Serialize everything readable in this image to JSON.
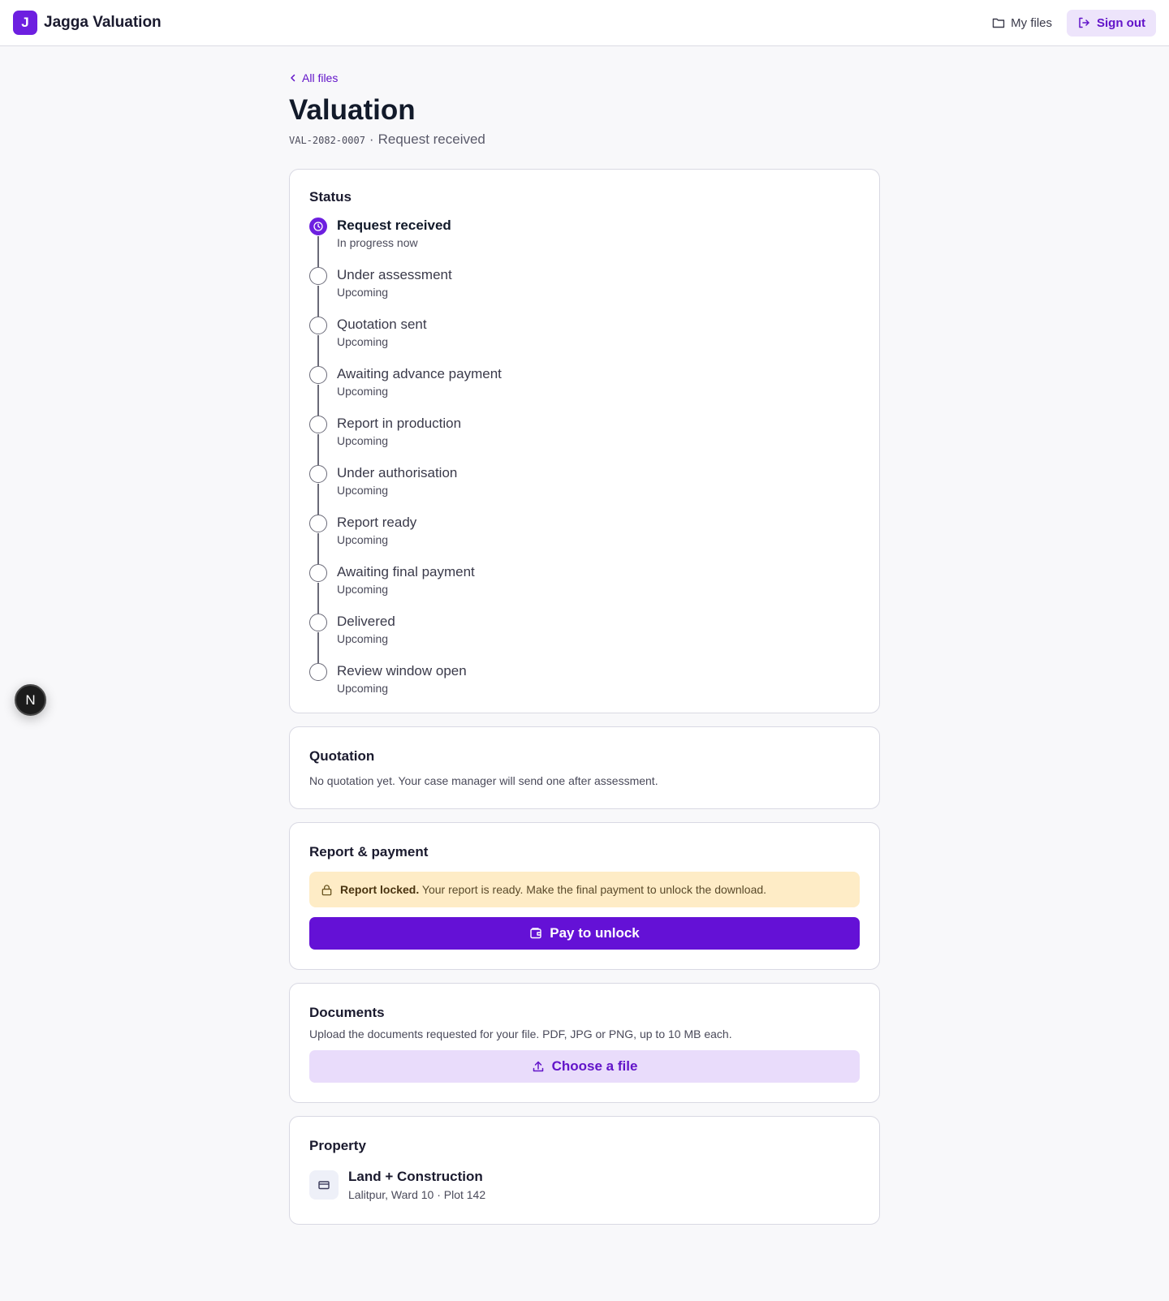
{
  "header": {
    "brand_initial": "J",
    "brand_name": "Jagga Valuation",
    "my_files_label": "My files",
    "sign_out_label": "Sign out"
  },
  "page": {
    "back_label": "All files",
    "title": "Valuation",
    "reference": "VAL-2082-0007",
    "separator": "·",
    "current_status": "Request received"
  },
  "status_card": {
    "title": "Status",
    "steps": [
      {
        "label": "Request received",
        "sub": "In progress now",
        "state": "current"
      },
      {
        "label": "Under assessment",
        "sub": "Upcoming",
        "state": "upcoming"
      },
      {
        "label": "Quotation sent",
        "sub": "Upcoming",
        "state": "upcoming"
      },
      {
        "label": "Awaiting advance payment",
        "sub": "Upcoming",
        "state": "upcoming"
      },
      {
        "label": "Report in production",
        "sub": "Upcoming",
        "state": "upcoming"
      },
      {
        "label": "Under authorisation",
        "sub": "Upcoming",
        "state": "upcoming"
      },
      {
        "label": "Report ready",
        "sub": "Upcoming",
        "state": "upcoming"
      },
      {
        "label": "Awaiting final payment",
        "sub": "Upcoming",
        "state": "upcoming"
      },
      {
        "label": "Delivered",
        "sub": "Upcoming",
        "state": "upcoming"
      },
      {
        "label": "Review window open",
        "sub": "Upcoming",
        "state": "upcoming"
      }
    ]
  },
  "quotation_card": {
    "title": "Quotation",
    "message": "No quotation yet. Your case manager will send one after assessment."
  },
  "report_card": {
    "title": "Report & payment",
    "banner_strong": "Report locked.",
    "banner_text": "Your report is ready. Make the final payment to unlock the download.",
    "pay_button": "Pay to unlock"
  },
  "documents_card": {
    "title": "Documents",
    "message": "Upload the documents requested for your file. PDF, JPG or PNG, up to 10 MB each.",
    "upload_button": "Choose a file"
  },
  "property_card": {
    "title": "Property",
    "type": "Land + Construction",
    "location": "Lalitpur, Ward 10 · Plot 142"
  },
  "floating": {
    "initial": "N"
  },
  "colors": {
    "accent": "#6d1fe0",
    "accent_soft": "#e9dcfb",
    "banner_bg": "#feecc6"
  },
  "icons": {
    "my_files": "folder-icon",
    "sign_out": "sign-out-icon",
    "back": "chevron-left-icon",
    "current_step": "clock-icon",
    "banner": "lock-icon",
    "pay": "wallet-icon",
    "upload": "upload-icon",
    "property": "id-card-icon"
  }
}
